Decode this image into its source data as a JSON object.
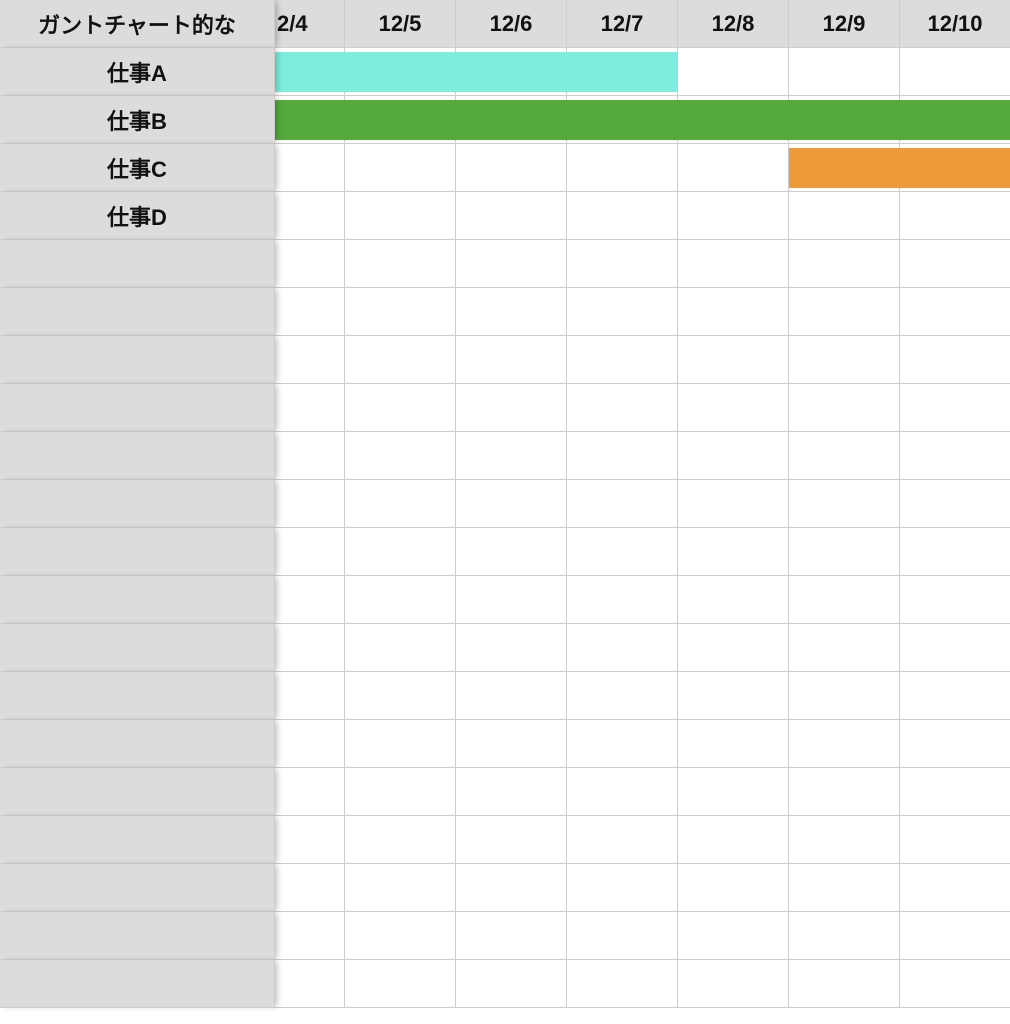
{
  "title": "ガントチャート的な",
  "columns": [
    "2/4",
    "12/5",
    "12/6",
    "12/7",
    "12/8",
    "12/9",
    "12/10"
  ],
  "tasks": [
    "仕事A",
    "仕事B",
    "仕事C",
    "仕事D"
  ],
  "bars": [
    {
      "row": 1,
      "startCol": 1,
      "span": 4,
      "color": "#7eeddd"
    },
    {
      "row": 2,
      "startCol": 1,
      "span": 7,
      "color": "#54ab3c"
    },
    {
      "row": 3,
      "startCol": 6,
      "span": 2,
      "color": "#ee9a3a"
    }
  ],
  "colors": {
    "headerBg": "#dcdcdc",
    "border": "#cdcdcd"
  },
  "chart_data": {
    "type": "bar",
    "title": "ガントチャート的な",
    "categories": [
      "2/4",
      "12/5",
      "12/6",
      "12/7",
      "12/8",
      "12/9",
      "12/10"
    ],
    "xlabel": "",
    "ylabel": "",
    "series": [
      {
        "name": "仕事A",
        "start": "2/4",
        "end": "12/7",
        "span": 4,
        "color": "#7eeddd"
      },
      {
        "name": "仕事B",
        "start": "2/4",
        "end": "12/10",
        "span": 7,
        "color": "#54ab3c"
      },
      {
        "name": "仕事C",
        "start": "12/9",
        "end": "12/10",
        "span": 2,
        "color": "#ee9a3a"
      },
      {
        "name": "仕事D",
        "start": null,
        "end": null,
        "span": 0,
        "color": null
      }
    ]
  }
}
